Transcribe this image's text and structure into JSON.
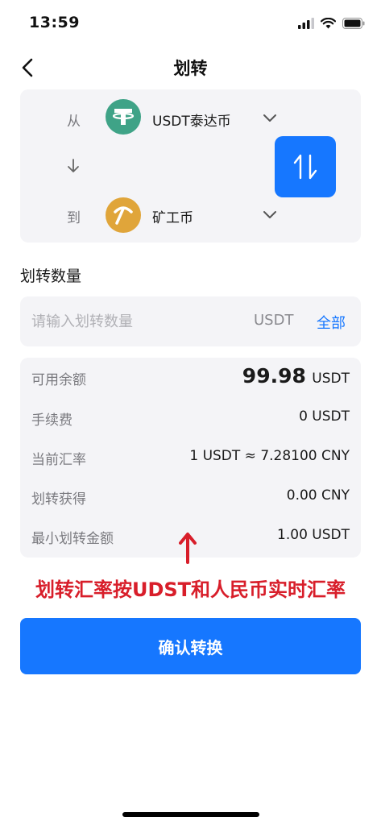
{
  "status_bar": {
    "time": "13:59",
    "icons": [
      "signal-icon",
      "wifi-icon",
      "battery-icon"
    ]
  },
  "nav": {
    "title": "划转",
    "back_icon": "chevron-left-icon"
  },
  "transfer": {
    "from_label": "从",
    "from_coin": "USDT泰达币",
    "from_icon": "tether-icon",
    "to_label": "到",
    "to_coin": "矿工币",
    "to_icon": "pickaxe-icon",
    "swap_icon": "swap-icon",
    "colors": {
      "tether": "#3fa387",
      "miner": "#e0a53a",
      "accent": "#1677ff"
    }
  },
  "amount": {
    "section_title": "划转数量",
    "placeholder": "请输入划转数量",
    "value": "",
    "unit": "USDT",
    "all_label": "全部"
  },
  "details": {
    "available": {
      "label": "可用余额",
      "value": "99.98",
      "unit": "USDT"
    },
    "fee": {
      "label": "手续费",
      "value": "0 USDT"
    },
    "rate": {
      "label": "当前汇率",
      "value": "1 USDT ≈ 7.28100 CNY"
    },
    "receive": {
      "label": "划转获得",
      "value": "0.00 CNY"
    },
    "minimum": {
      "label": "最小划转金额",
      "value": "1.00 USDT"
    }
  },
  "annotation": {
    "text": "划转汇率按UDST和人民币实时汇率",
    "color": "#d81e2a"
  },
  "confirm": {
    "label": "确认转换"
  }
}
